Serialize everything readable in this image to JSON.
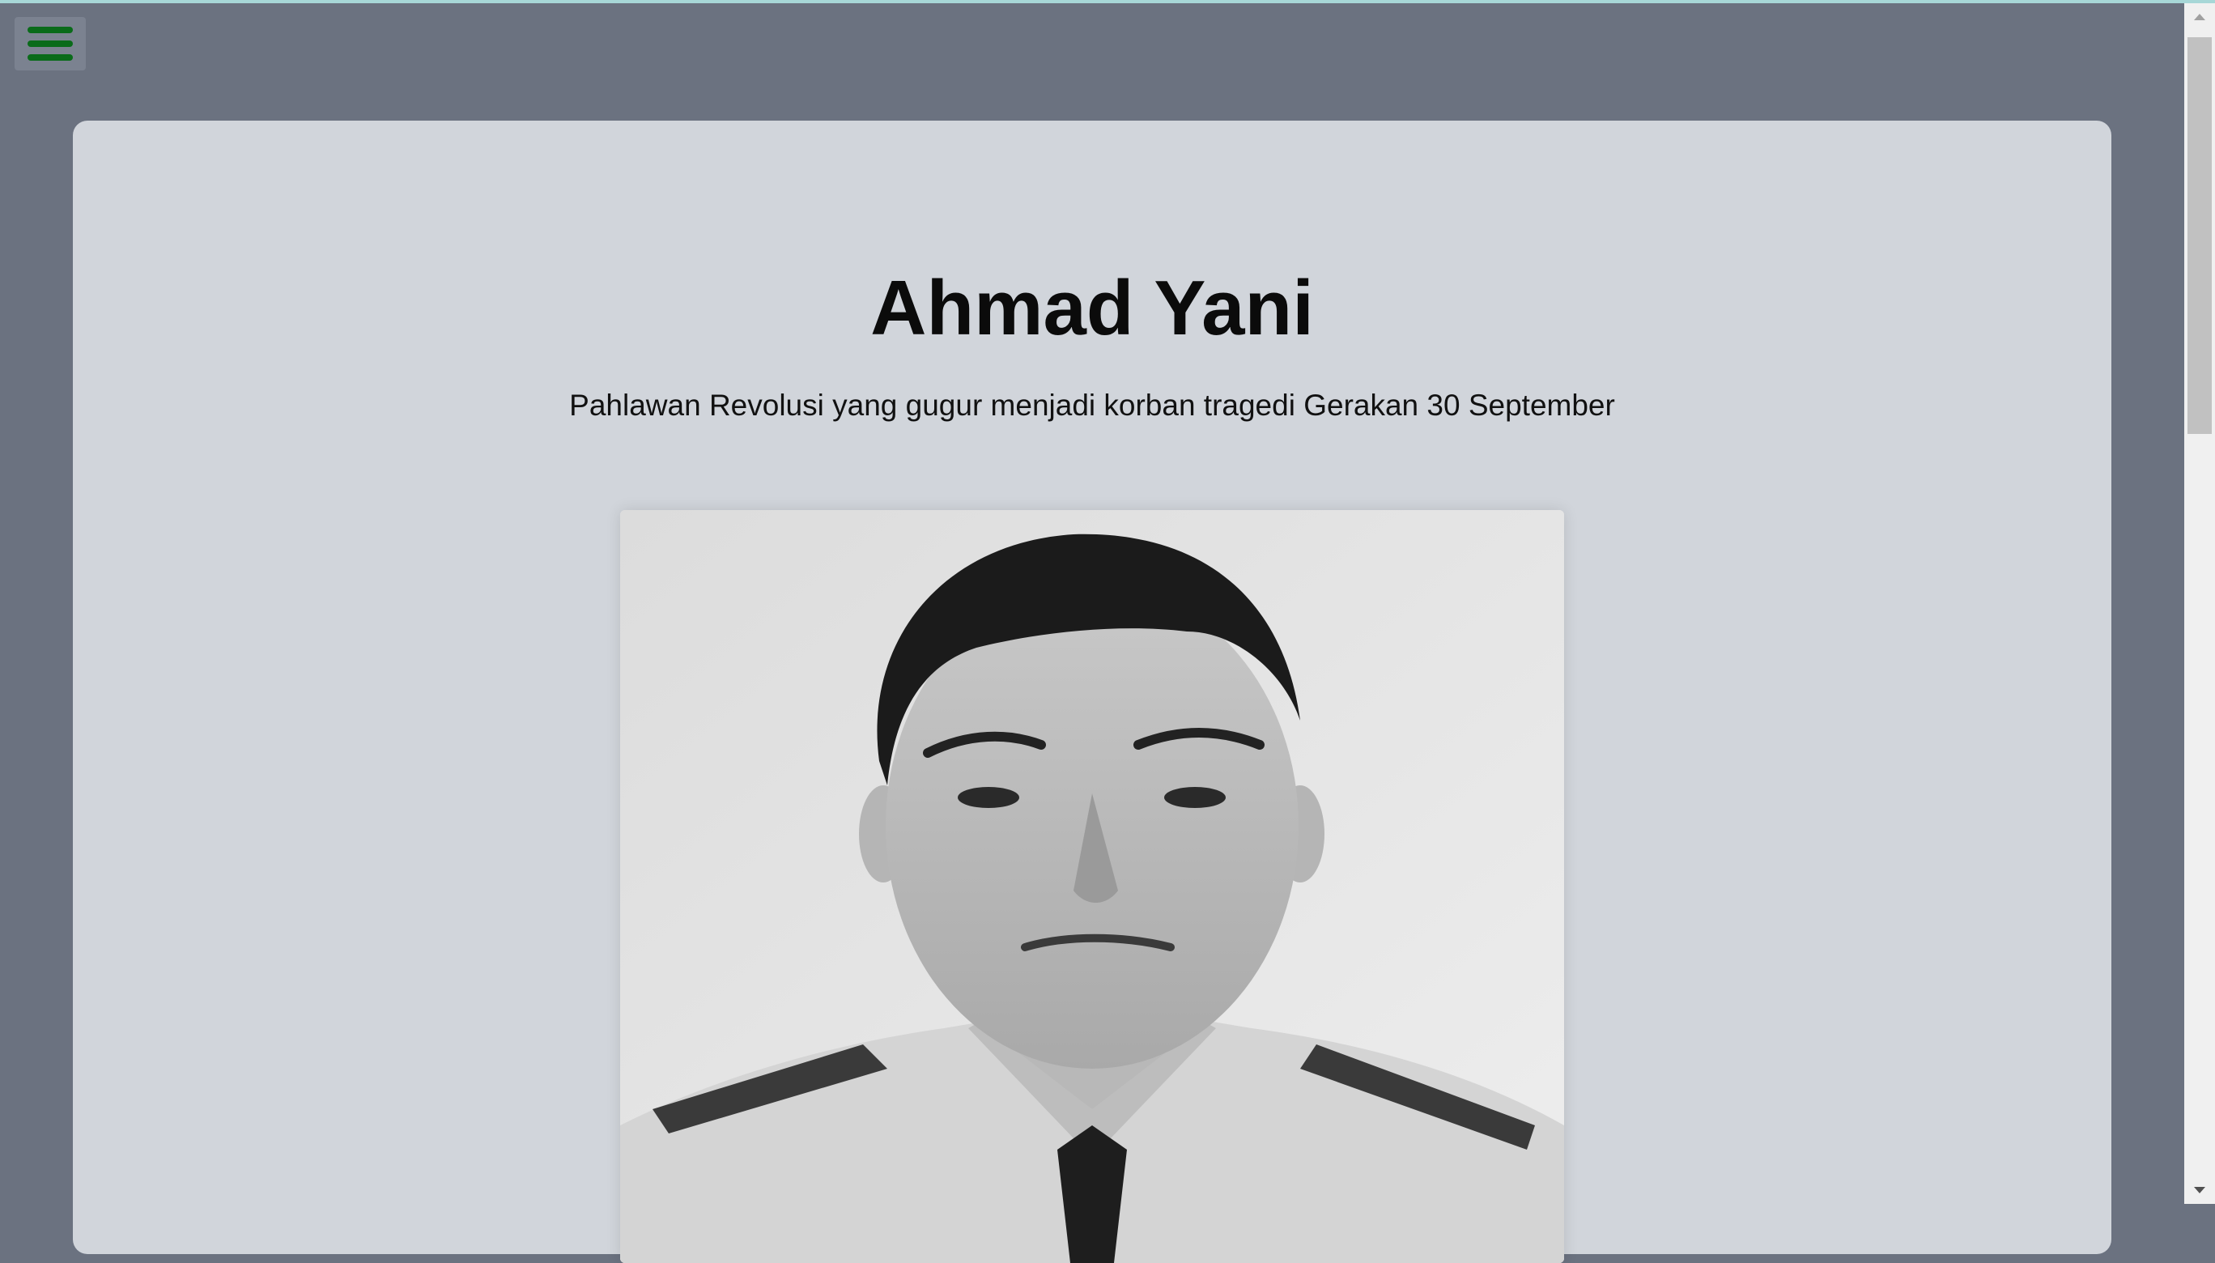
{
  "header": {
    "menu_icon": "hamburger-menu-icon",
    "accent_color": "#0a6b1a"
  },
  "hero": {
    "title": "Ahmad Yani",
    "subtitle": "Pahlawan Revolusi yang gugur menjadi korban tragedi Gerakan 30 September",
    "image_subject": "black-and-white portrait photo"
  },
  "scrollbar": {
    "up_icon": "scroll-up-arrow-icon",
    "down_icon": "scroll-down-arrow-icon"
  },
  "colors": {
    "page_background": "#6b7280",
    "card_background": "#d1d5db",
    "title_text": "#0b0b0b"
  }
}
